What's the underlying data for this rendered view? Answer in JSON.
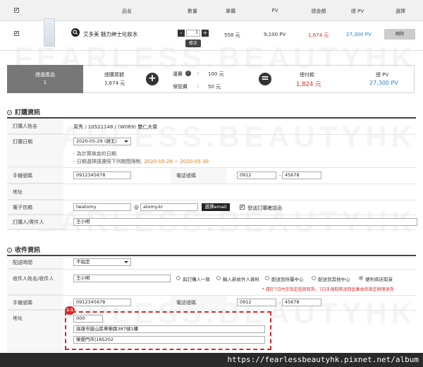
{
  "watermark": "FEARLESS.BEAUTYHK",
  "cart": {
    "headers": {
      "name": "品名",
      "qty": "數量",
      "price": "單價",
      "pv": "PV",
      "total": "總金額",
      "total_pv": "總 PV",
      "select": "選擇"
    },
    "item": {
      "name": "艾多美 魅力紳士化妝水",
      "qty": "3",
      "qty_minus": "-",
      "qty_plus": "+",
      "modify": "修正",
      "price": "558 元",
      "pv": "9,100 PV",
      "total": "1,674 元",
      "total_pv": "27,300 PV",
      "delete": "刪除"
    }
  },
  "summary": {
    "selected_label": "總選產品",
    "selected_value": "1",
    "amount_label": "總購買額",
    "amount_value": "1,674 元",
    "plus": "+",
    "freight_label": "運費",
    "freight_value": "100 元",
    "insurance_label": "保管費",
    "insurance_value": "50 元",
    "equals": "=",
    "pay_label": "總付款",
    "pay_value": "1,824 元",
    "pv_label": "總 PV",
    "pv_value": "27,300 PV",
    "pay_color": "#d0312d",
    "pv_color": "#2a7fc4"
  },
  "order": {
    "title": "訂購資訊",
    "name_label": "訂購人姓名",
    "name_value": "周秀 / 10521148 / (W069) 雙仁大榮",
    "date_label": "訂購日期",
    "date_value": "2020-05-29 (週五)",
    "date_note1": "- 為計算換金的日期.",
    "date_note2": "- 日期選擇請遵照下列期間限制.",
    "date_range": "2020-05-28 ~ 2020-05-30",
    "mobile_label": "手機號碼",
    "mobile_value": "0912345678",
    "phone_label": "電話號碼",
    "phone_1": "0912",
    "phone_sep": "-",
    "phone_2": "45678",
    "address_label": "地址",
    "email_label": "電子信箱",
    "email_user": "twatomy",
    "email_at": "@",
    "email_domain": "atomy.kr",
    "email_btn": "選擇email",
    "email_check_label": "發送訂購確認函",
    "sender_label": "訂購人/寄件人",
    "sender_value": "王小明"
  },
  "receiver": {
    "title": "收件資訊",
    "time_label": "配送時間",
    "time_value": "不指定",
    "name_label": "收件人姓名/收件人",
    "name_value": "王小明",
    "options": [
      "與訂購人一致",
      "輸入新收件人資料",
      "配送到所屬中心",
      "配送到其他中心",
      "便利商店取貨"
    ],
    "notice": "* 請於7日內至指定超商取貨，7日未領取將退回倉庫並依規定辦理退貨",
    "mobile_label": "手機號碼",
    "mobile_value": "0912345678",
    "phone_label": "電話號碼",
    "phone_1": "0912",
    "phone_sep": "-",
    "phone_2": "45678",
    "address_label": "地址",
    "badge": "1-1",
    "zip": "000",
    "addr1": "高雄市鼓山區華榮路387號1樓",
    "addr2": "榮愛門市|185202"
  },
  "footer": "https://fearlessbeautyhk.pixnet.net/album"
}
